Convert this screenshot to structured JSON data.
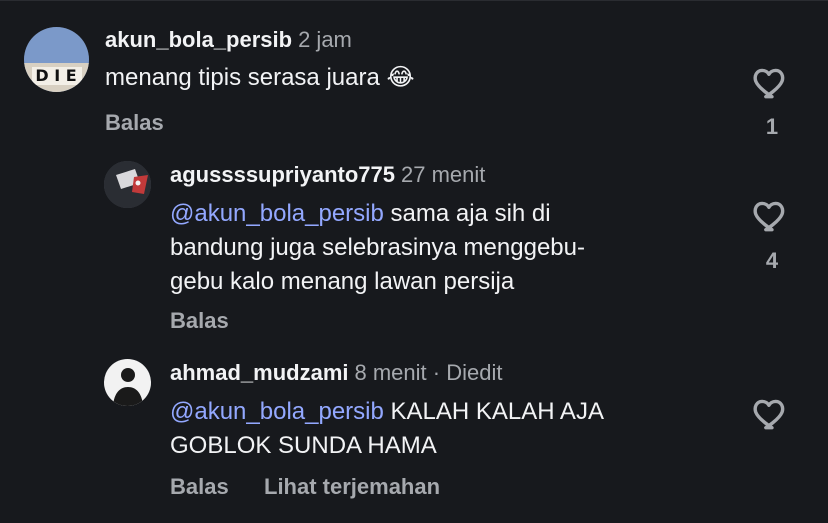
{
  "comments": [
    {
      "username": "akun_bola_persib",
      "time": "2 jam",
      "text": "menang tipis serasa juara 😂",
      "reply_label": "Balas",
      "likes": "1"
    },
    {
      "username": "agussssupriyanto775",
      "time": "27 menit",
      "mention": "@akun_bola_persib",
      "text_line1_rest": "sama aja sih di",
      "text_line2": "bandung juga selebrasinya menggebu-",
      "text_line3": "gebu kalo menang lawan persija",
      "reply_label": "Balas",
      "likes": "4"
    },
    {
      "username": "ahmad_mudzami",
      "meta": "8 menit · Diedit",
      "mention": "@akun_bola_persib",
      "text_line1_rest": "KALAH KALAH AJA",
      "text_line2": "GOBLOK SUNDA HAMA",
      "reply_label": "Balas",
      "translate_label": "Lihat terjemahan"
    }
  ],
  "icons": {
    "like": "heart-outline-icon"
  },
  "colors": {
    "background": "#17191d",
    "mention": "#93a8ff",
    "secondary_text": "#a6a9ae"
  }
}
